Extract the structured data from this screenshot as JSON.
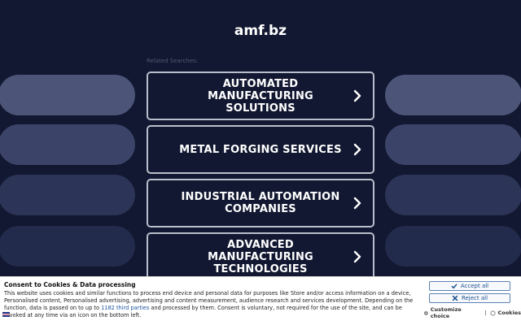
{
  "header": {
    "domain": "amf.bz"
  },
  "related": {
    "label": "Related Searches:",
    "items": [
      {
        "label": "AUTOMATED MANUFACTURING SOLUTIONS",
        "icon": "chevron-right-icon"
      },
      {
        "label": "METAL FORGING SERVICES",
        "icon": "chevron-right-icon"
      },
      {
        "label": "INDUSTRIAL AUTOMATION COMPANIES",
        "icon": "chevron-right-icon"
      },
      {
        "label": "ADVANCED MANUFACTURING TECHNOLOGIES",
        "icon": "chevron-right-icon"
      }
    ]
  },
  "colors": {
    "background": "#121831",
    "pill_1": "#4c5578",
    "pill_2": "#3b4468",
    "pill_3": "#2c3457",
    "pill_4": "#232b4c",
    "card_border": "#b9bfcc",
    "link": "#1a55a0"
  },
  "consent": {
    "title": "Consent to Cookies & Data processing",
    "text_before": "This website uses cookies and similar functions to process end device and personal data for purposes like Store and/or access information on a device, Personalised content, Personalised advertising, advertising and content measurement, audience research and services development. Depending on the function, data is passed on to up to ",
    "third_parties_link": "1182 third parties",
    "text_after": " and processed by them. Consent is voluntary, not required for the use of the site, and can be revoked at any time via an icon on the bottom left.",
    "accept_label": "Accept all",
    "reject_label": "Reject all",
    "customize_label": "Customize choice",
    "separator": "|",
    "cookies_label": "Cookies"
  }
}
